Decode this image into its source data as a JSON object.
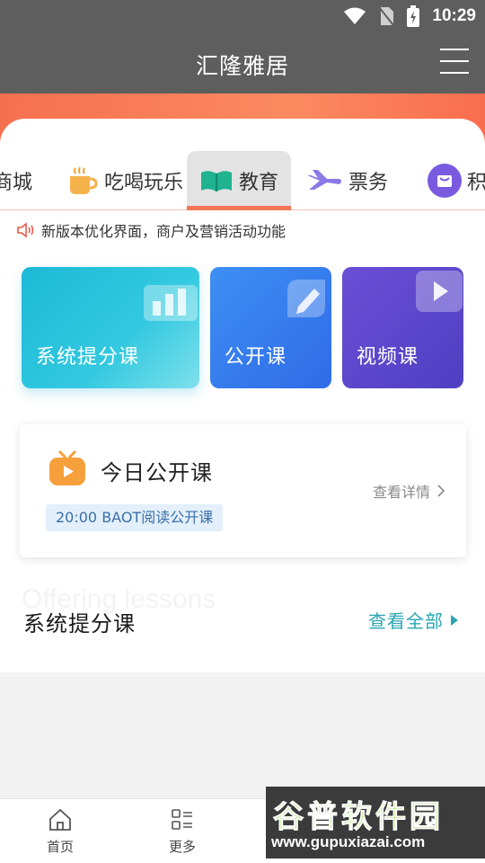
{
  "status_bar": {
    "time": "10:29"
  },
  "header": {
    "title": "汇隆雅居"
  },
  "category_tabs": [
    {
      "label": "商城",
      "icon": "shop-icon"
    },
    {
      "label": "吃喝玩乐",
      "icon": "coffee-cup-icon"
    },
    {
      "label": "教育",
      "icon": "open-book-icon",
      "active": true
    },
    {
      "label": "票务",
      "icon": "airplane-icon"
    },
    {
      "label": "积",
      "icon": "gift-bag-icon"
    }
  ],
  "notice": {
    "text": "新版本优化界面，商户及营销活动功能",
    "icon": "speaker-icon"
  },
  "courses": [
    {
      "label": "系统提分课",
      "icon": "bar-chart-icon"
    },
    {
      "label": "公开课",
      "icon": "pencil-icon"
    },
    {
      "label": "视频课",
      "icon": "video-play-icon"
    }
  ],
  "today_class": {
    "title": "今日公开课",
    "item": "20:00 BAOT阅读公开课",
    "detail_link": "查看详情"
  },
  "section": {
    "bg_text": "Offering lessons",
    "title": "系统提分课",
    "view_all": "查看全部"
  },
  "bottom_nav": [
    {
      "label": "首页",
      "icon": "home-icon"
    },
    {
      "label": "更多",
      "icon": "menu-grid-icon"
    }
  ],
  "watermark": {
    "line1": "谷普软件园",
    "line2": "www.gupuxiazai.com"
  },
  "colors": {
    "accent": "#f57554",
    "teal": "#2aa6b3",
    "header": "#5e5e5e"
  }
}
